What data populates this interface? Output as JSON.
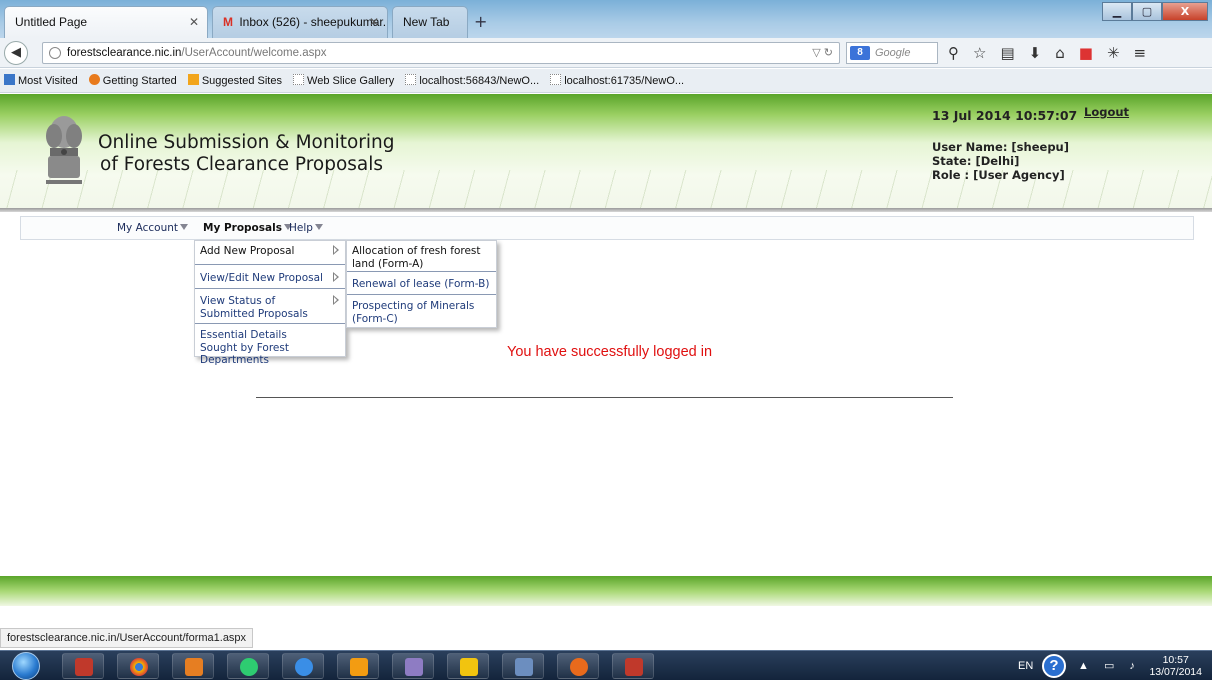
{
  "browser": {
    "tabs": [
      {
        "title": "Untitled Page",
        "active": true
      },
      {
        "title": "Inbox (526) - sheepukumar...",
        "active": false
      },
      {
        "title": "New Tab",
        "active": false
      }
    ],
    "url_host": "forestsclearance.nic.in",
    "url_path": "/UserAccount/welcome.aspx",
    "search_placeholder": "Google",
    "window_buttons": {
      "minimize": "▁",
      "maximize": "▢",
      "close": "X"
    },
    "bookmarks": [
      "Most Visited",
      "Getting Started",
      "Suggested Sites",
      "Web Slice Gallery",
      "localhost:56843/NewO...",
      "localhost:61735/NewO..."
    ],
    "status_url": "forestsclearance.nic.in/UserAccount/forma1.aspx"
  },
  "header": {
    "title_line1": "Online Submission & Monitoring",
    "title_line2": "of Forests Clearance Proposals",
    "datetime": "13 Jul 2014 10:57:07",
    "logout": "Logout",
    "user_name": "User Name: [sheepu]",
    "state": "State: [Delhi]",
    "role": "Role : [User Agency]"
  },
  "menu": {
    "items": [
      "My Account",
      "My Proposals",
      "Help"
    ],
    "dropdown": [
      "Add New Proposal",
      "View/Edit New Proposal",
      "View Status of Submitted Proposals",
      "Essential Details Sought by Forest Departments"
    ],
    "submenu": [
      "Allocation of fresh forest land (Form-A)",
      "Renewal of lease (Form-B)",
      "Prospecting of Minerals (Form-C)"
    ]
  },
  "main": {
    "message": "You have successfully logged in"
  },
  "taskbar": {
    "language": "EN",
    "time": "10:57",
    "date": "13/07/2014"
  },
  "colors": {
    "success_text": "#e01010",
    "menu_link": "#1f3b7a",
    "banner_green": "#5aa52a"
  }
}
